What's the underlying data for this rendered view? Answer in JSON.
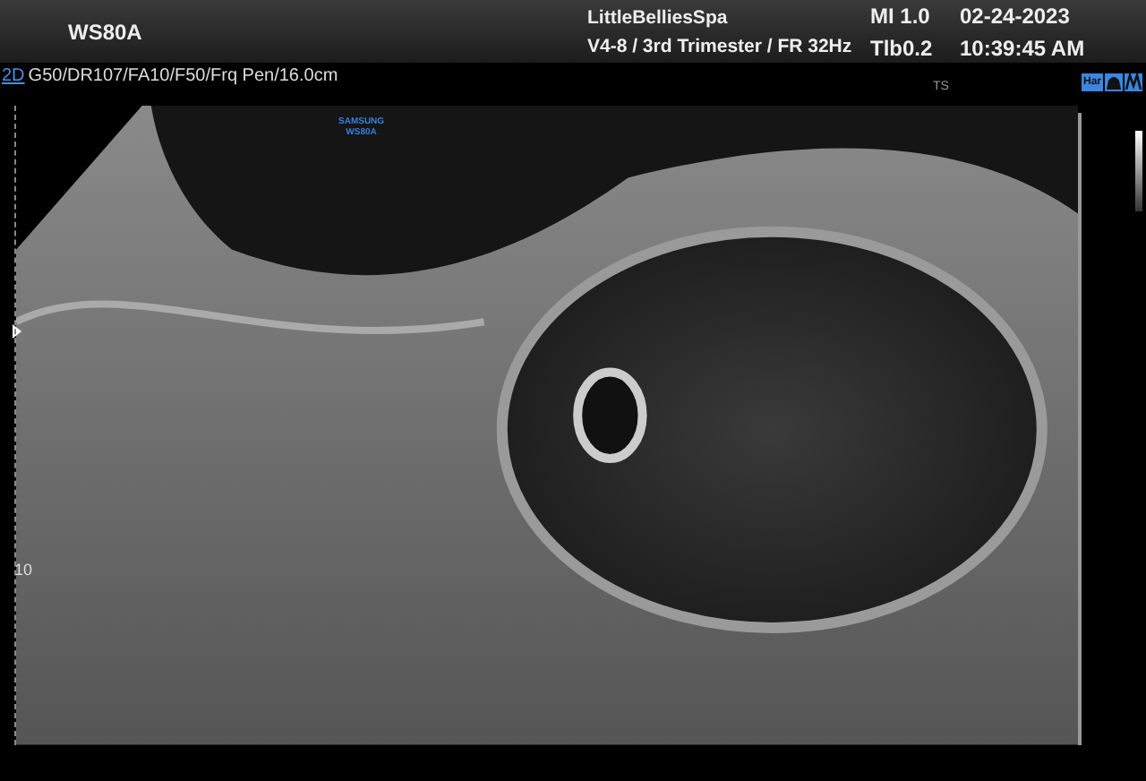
{
  "header": {
    "model": "WS80A",
    "clinic": "LittleBelliesSpa",
    "preset": "V4-8 / 3rd Trimester / FR 32Hz",
    "mi": "MI  1.0",
    "tib": "Tlb0.2",
    "date": "02-24-2023",
    "time": "10:39:45 AM"
  },
  "params": {
    "mode": "2D",
    "settings": "G50/DR107/FA10/F50/Frq Pen/16.0cm"
  },
  "mode_badges": [
    {
      "label": "Har",
      "kind": "text"
    },
    {
      "kind": "probe"
    },
    {
      "kind": "wave"
    }
  ],
  "image": {
    "brand": "SAMSUNG",
    "model": "WS80A",
    "orientation": "TS",
    "depth_label": "10"
  }
}
